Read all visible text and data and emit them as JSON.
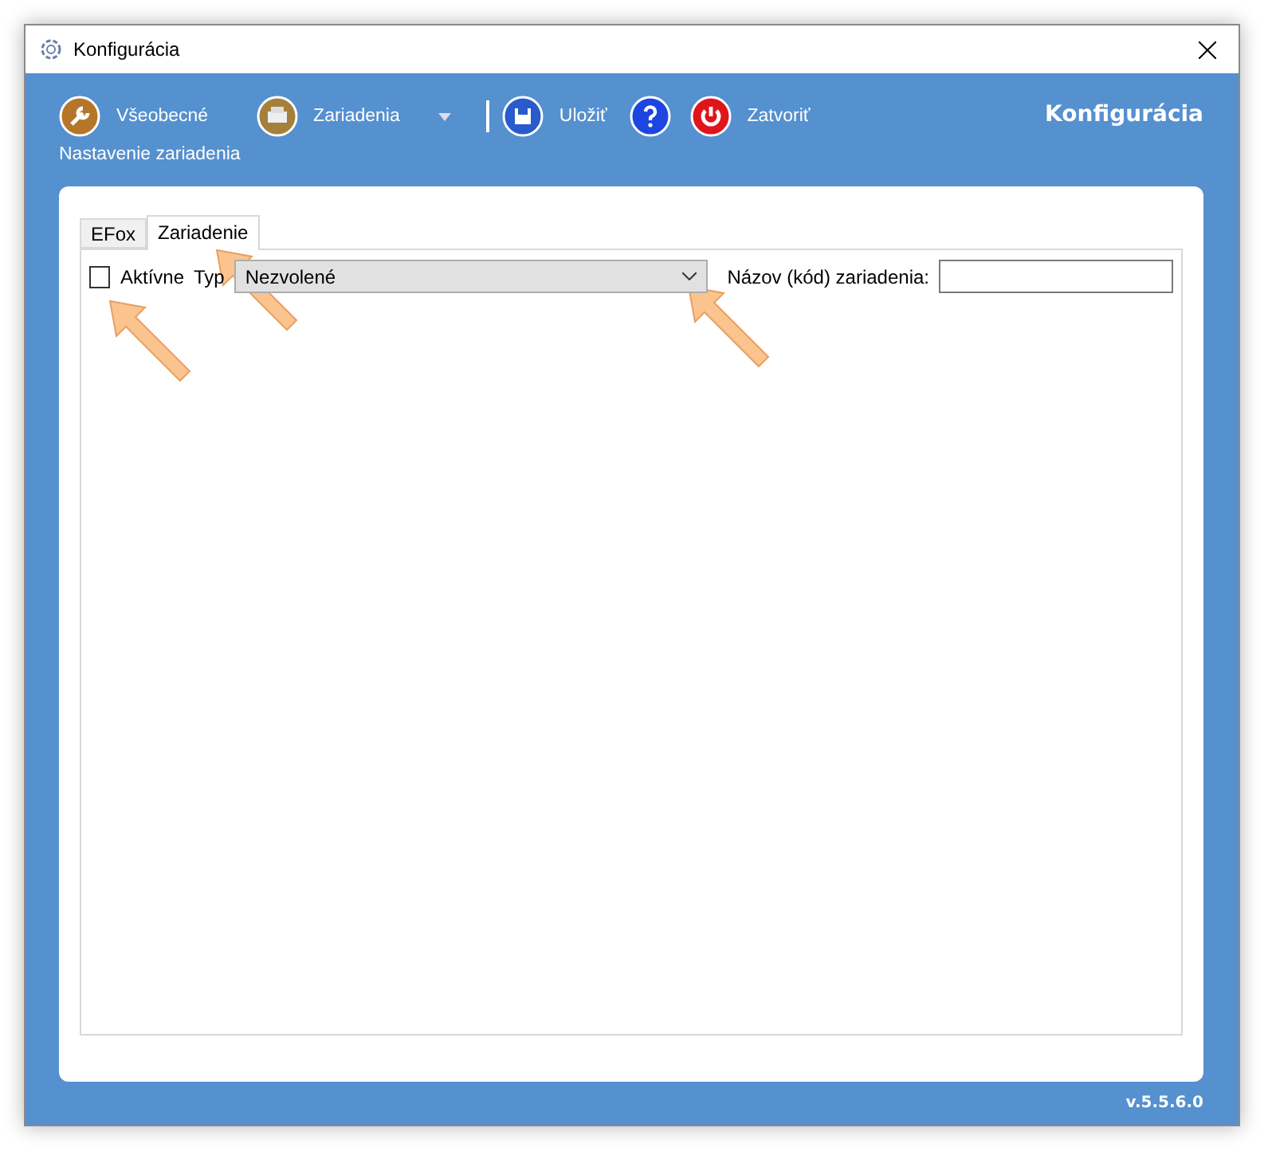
{
  "window": {
    "title": "Konfigurácia"
  },
  "toolbar": {
    "items": [
      {
        "kind": "wrench",
        "label": "Všeobecné"
      },
      {
        "kind": "device",
        "label": "Zariadenia",
        "dropdown": true
      },
      {
        "kind": "separator"
      },
      {
        "kind": "save",
        "label": "Uložiť"
      },
      {
        "kind": "help"
      },
      {
        "kind": "power",
        "label": "Zatvoriť"
      }
    ],
    "subtitle": "Nastavenie zariadenia",
    "heading": "Konfigurácia"
  },
  "tabs": [
    {
      "label": "EFox",
      "selected": false
    },
    {
      "label": "Zariadenie",
      "selected": true
    }
  ],
  "form": {
    "active": {
      "label": "Aktívne",
      "checked": false
    },
    "type": {
      "label": "Typ",
      "value": "Nezvolené"
    },
    "name": {
      "label": "Názov (kód) zariadenia:"
    }
  },
  "version": "v.5.5.6.0"
}
